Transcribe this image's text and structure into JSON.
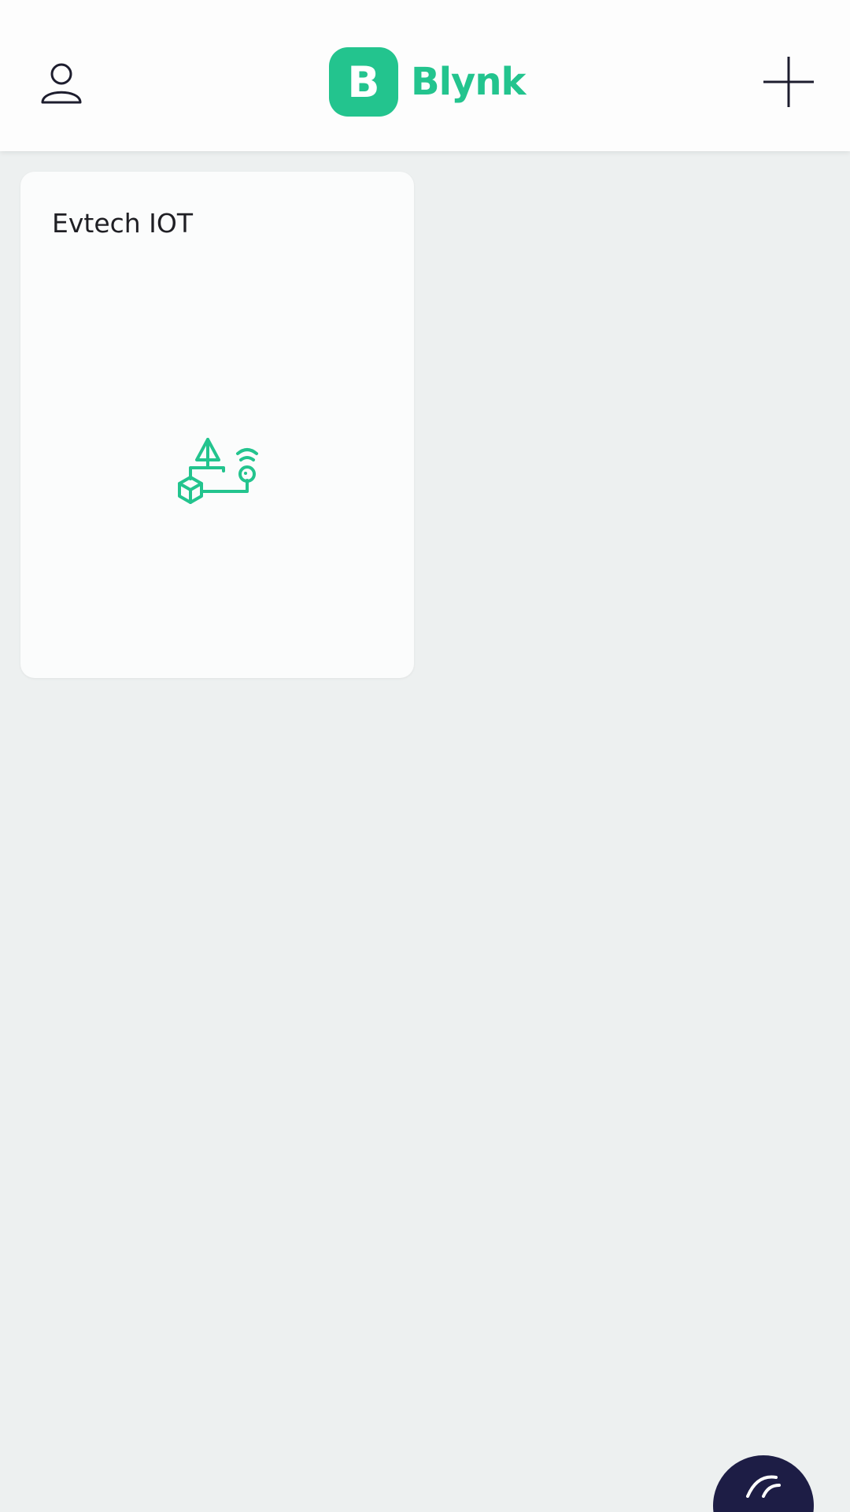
{
  "header": {
    "profile_icon": "user-outline-icon",
    "logo": {
      "badge_letter": "B",
      "text": "Blynk",
      "color": "#23c48e"
    },
    "add_icon": "plus-icon"
  },
  "devices": [
    {
      "name": "Evtech IOT",
      "illustration_icon": "iot-device-illustration-icon"
    }
  ],
  "fab": {
    "icon": "partial-round-icon",
    "color": "#1d1d45"
  }
}
